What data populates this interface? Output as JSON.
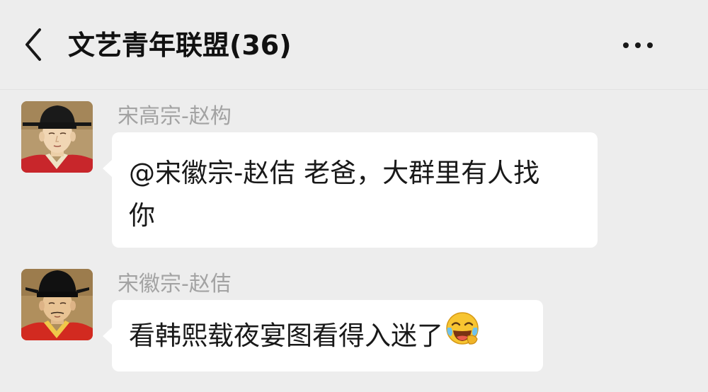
{
  "header": {
    "title": "文艺青年联盟(36)",
    "back_icon": "chevron-left-icon",
    "more_icon": "more-horizontal-icon"
  },
  "messages": [
    {
      "sender": "宋高宗-赵构",
      "lines": [
        "@宋徽宗-赵佶 老爸，大群里有人找",
        "你"
      ]
    },
    {
      "sender": "宋徽宗-赵佶",
      "text": "看韩熙载夜宴图看得入迷了",
      "emoji": "laughing-crying-face-emoji"
    }
  ],
  "colors": {
    "background": "#ededed",
    "bubble": "#ffffff",
    "sender_name": "#a3a3a3",
    "text": "#191919"
  }
}
